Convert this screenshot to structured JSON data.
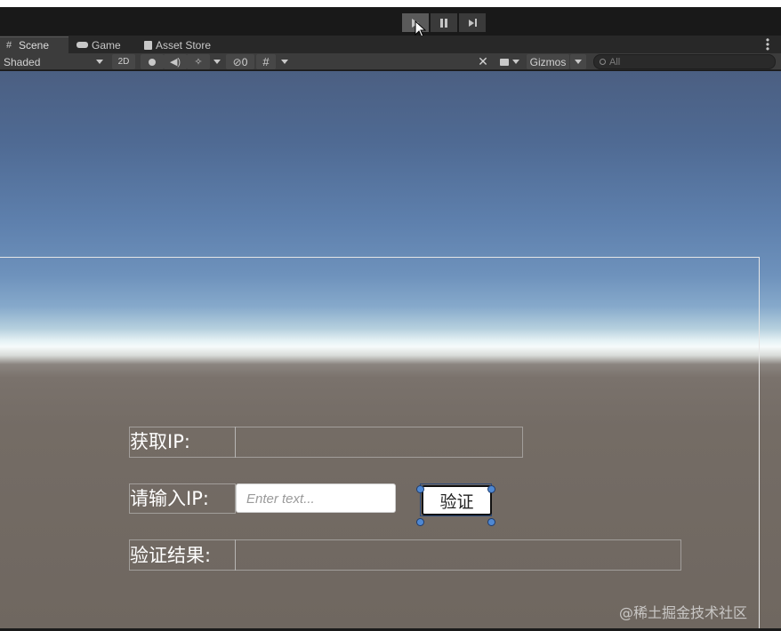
{
  "playbar": {
    "play_icon": "play-icon",
    "pause_icon": "pause-icon",
    "step_icon": "step-icon"
  },
  "tabs": [
    {
      "label": "Scene",
      "icon": "grid-icon",
      "active": true
    },
    {
      "label": "Game",
      "icon": "gamepad-icon",
      "active": false
    },
    {
      "label": "Asset Store",
      "icon": "bag-icon",
      "active": false
    }
  ],
  "toolbar": {
    "shading_mode": "Shaded",
    "mode_2d": "2D",
    "hidden_count": "0",
    "gizmos": "Gizmos",
    "search_placeholder": "All"
  },
  "ui": {
    "get_ip_label": "获取IP:",
    "get_ip_value": "",
    "input_ip_label": "请输入IP:",
    "input_placeholder": "Enter text...",
    "verify_button": "验证",
    "result_label": "验证结果:",
    "result_value": ""
  },
  "watermark": "@稀土掘金技术社区",
  "colors": {
    "editor_bg": "#191919",
    "toolbar_bg": "#3c3c3c",
    "handle_blue": "#4f88d2"
  }
}
